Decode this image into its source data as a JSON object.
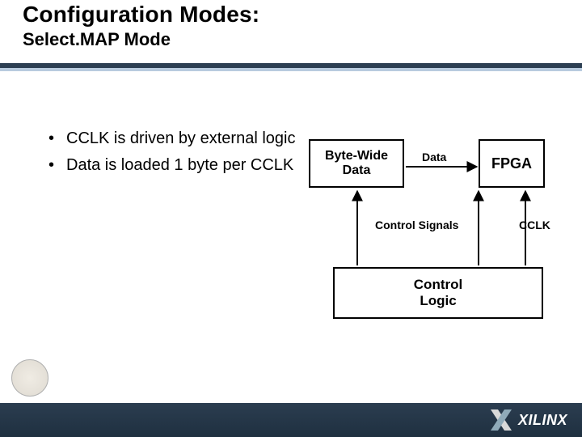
{
  "title": {
    "main": "Configuration Modes:",
    "sub": "Select.MAP Mode"
  },
  "bullets": [
    "CCLK is driven by external logic",
    "Data is loaded 1 byte per CCLK"
  ],
  "diagram": {
    "box_bytewide": "Byte-Wide\nData",
    "box_fpga": "FPGA",
    "box_control": "Control\nLogic",
    "label_data": "Data",
    "label_control_signals": "Control Signals",
    "label_cclk": "CCLK"
  },
  "footer": {
    "brand": "XILINX"
  }
}
